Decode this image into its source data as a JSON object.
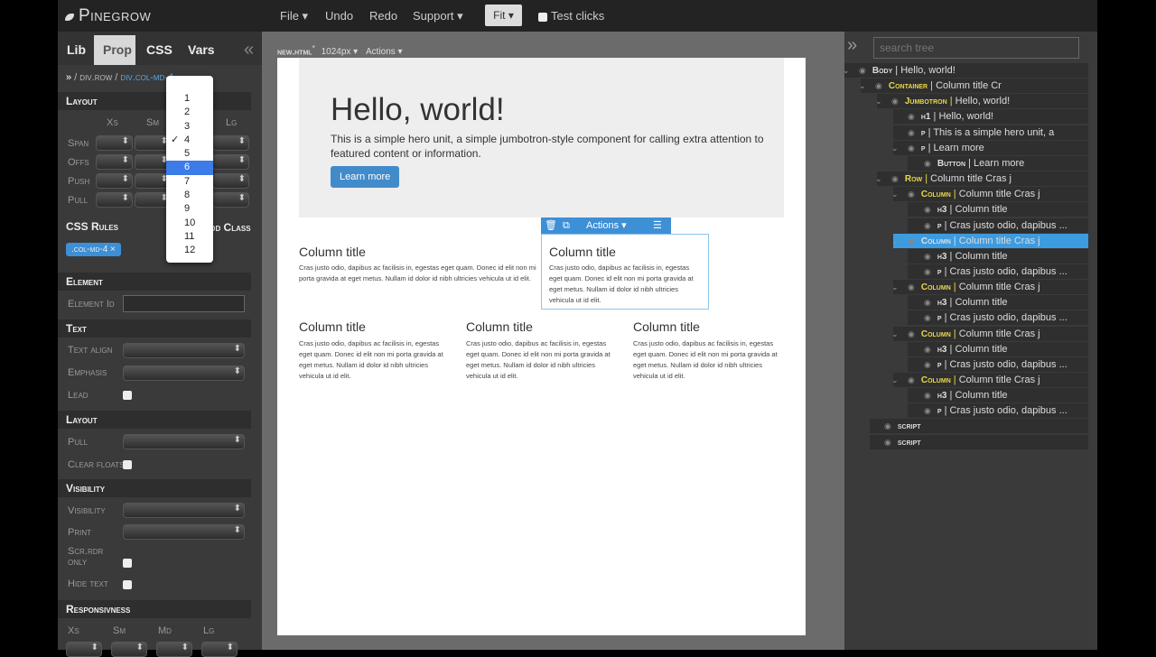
{
  "topbar": {
    "logo": "Pinegrow",
    "menus": [
      "File ▾",
      "Undo",
      "Redo",
      "Support ▾"
    ],
    "fit": "Fit ▾",
    "test_clicks": "Test clicks"
  },
  "left": {
    "tabs": [
      "Lib",
      "Prop",
      "CSS",
      "Vars"
    ],
    "active_tab": "Prop",
    "collapse": "«",
    "breadcrumb": [
      "»",
      "div.row",
      "div.col-md-4"
    ],
    "layout": {
      "title": "Layout",
      "cols": [
        "Xs",
        "Sm",
        "Md",
        "Lg"
      ],
      "rows": [
        "Span",
        "Offs",
        "Push",
        "Pull"
      ]
    },
    "css_rules": {
      "title": "CSS Rules",
      "add_class": "Add Class",
      "chip": ".col-md-4 ×"
    },
    "element": {
      "title": "Element",
      "id_label": "Element Id"
    },
    "text": {
      "title": "Text",
      "align": "Text align",
      "emphasis": "Emphasis",
      "lead": "Lead"
    },
    "layout2": {
      "title": "Layout",
      "pull": "Pull",
      "clear": "Clear floats"
    },
    "visibility": {
      "title": "Visibility",
      "visibility": "Visibility",
      "print": "Print",
      "scr1": "Scr.rdr",
      "scr2": "only",
      "hide": "Hide text"
    },
    "responsive": {
      "title": "Responsivness",
      "cols": [
        "Xs",
        "Sm",
        "Md",
        "Lg"
      ]
    },
    "dropdown": {
      "options": [
        "1",
        "2",
        "3",
        "4",
        "5",
        "6",
        "7",
        "8",
        "9",
        "10",
        "11",
        "12"
      ],
      "checked": "4",
      "highlighted": "6"
    }
  },
  "canvas": {
    "file": "new.html",
    "modified": "*",
    "width": "1024px ▾",
    "actions": "Actions ▾",
    "jumbotron": {
      "h1": "Hello, world!",
      "p": "This is a simple hero unit, a simple jumbotron-style component for calling extra attention to featured content or information.",
      "button": "Learn more"
    },
    "sel_toolbar": {
      "actions": "Actions ▾"
    },
    "col_title": "Column title",
    "col_text_long": "Cras justo odio, dapibus ac facilisis in, egestas eget quam. Donec id elit non mi porta gravida at eget metus. Nullam id dolor id nibh ultricies vehicula ut id elit.",
    "col_text": "Cras justo odio, dapibus ac facilisis in, egestas eget quam. Donec id elit non mi porta gravida at eget metus. Nullam id dolor id nibh ultricies vehicula ut id elit."
  },
  "right": {
    "expand": "»",
    "search_placeholder": "search tree",
    "tree": [
      {
        "tag": "Body",
        "text": "Hello, world!",
        "lvl": 0,
        "exp": true
      },
      {
        "tag": "Container",
        "text": "Column title Cr",
        "lvl": 1,
        "exp": true,
        "y": true
      },
      {
        "tag": "Jumbotron",
        "text": "Hello, world!",
        "lvl": 2,
        "exp": true,
        "y": true
      },
      {
        "tag": "h1",
        "text": "Hello, world!",
        "lvl": 3
      },
      {
        "tag": "p",
        "text": "This is a simple hero unit, a",
        "lvl": 3
      },
      {
        "tag": "p",
        "text": "Learn more",
        "lvl": 3,
        "exp": true
      },
      {
        "tag": "Button",
        "text": "Learn more",
        "lvl": 4
      },
      {
        "tag": "Row",
        "text": "Column title Cras j",
        "lvl": 2,
        "exp": true,
        "y": true
      },
      {
        "tag": "Column",
        "text": "Column title Cras j",
        "lvl": 3,
        "exp": true,
        "y": true
      },
      {
        "tag": "h3",
        "text": "Column title",
        "lvl": 4
      },
      {
        "tag": "p",
        "text": "Cras justo odio, dapibus ...",
        "lvl": 4
      },
      {
        "tag": "Column",
        "text": "Column title Cras j",
        "lvl": 3,
        "exp": true,
        "y": true,
        "sel": true
      },
      {
        "tag": "h3",
        "text": "Column title",
        "lvl": 4
      },
      {
        "tag": "p",
        "text": "Cras justo odio, dapibus ...",
        "lvl": 4
      },
      {
        "tag": "Column",
        "text": "Column title Cras j",
        "lvl": 3,
        "exp": true,
        "y": true
      },
      {
        "tag": "h3",
        "text": "Column title",
        "lvl": 4
      },
      {
        "tag": "p",
        "text": "Cras justo odio, dapibus ...",
        "lvl": 4
      },
      {
        "tag": "Column",
        "text": "Column title Cras j",
        "lvl": 3,
        "exp": true,
        "y": true
      },
      {
        "tag": "h3",
        "text": "Column title",
        "lvl": 4
      },
      {
        "tag": "p",
        "text": "Cras justo odio, dapibus ...",
        "lvl": 4
      },
      {
        "tag": "Column",
        "text": "Column title Cras j",
        "lvl": 3,
        "exp": true,
        "y": true
      },
      {
        "tag": "h3",
        "text": "Column title",
        "lvl": 4
      },
      {
        "tag": "p",
        "text": "Cras justo odio, dapibus ...",
        "lvl": 4
      },
      {
        "tag": "script",
        "text": "",
        "lvl": 1
      },
      {
        "tag": "script",
        "text": "",
        "lvl": 1
      }
    ]
  },
  "colors": {
    "accent": "#3d9be0",
    "highlight": "#e8d84a"
  }
}
